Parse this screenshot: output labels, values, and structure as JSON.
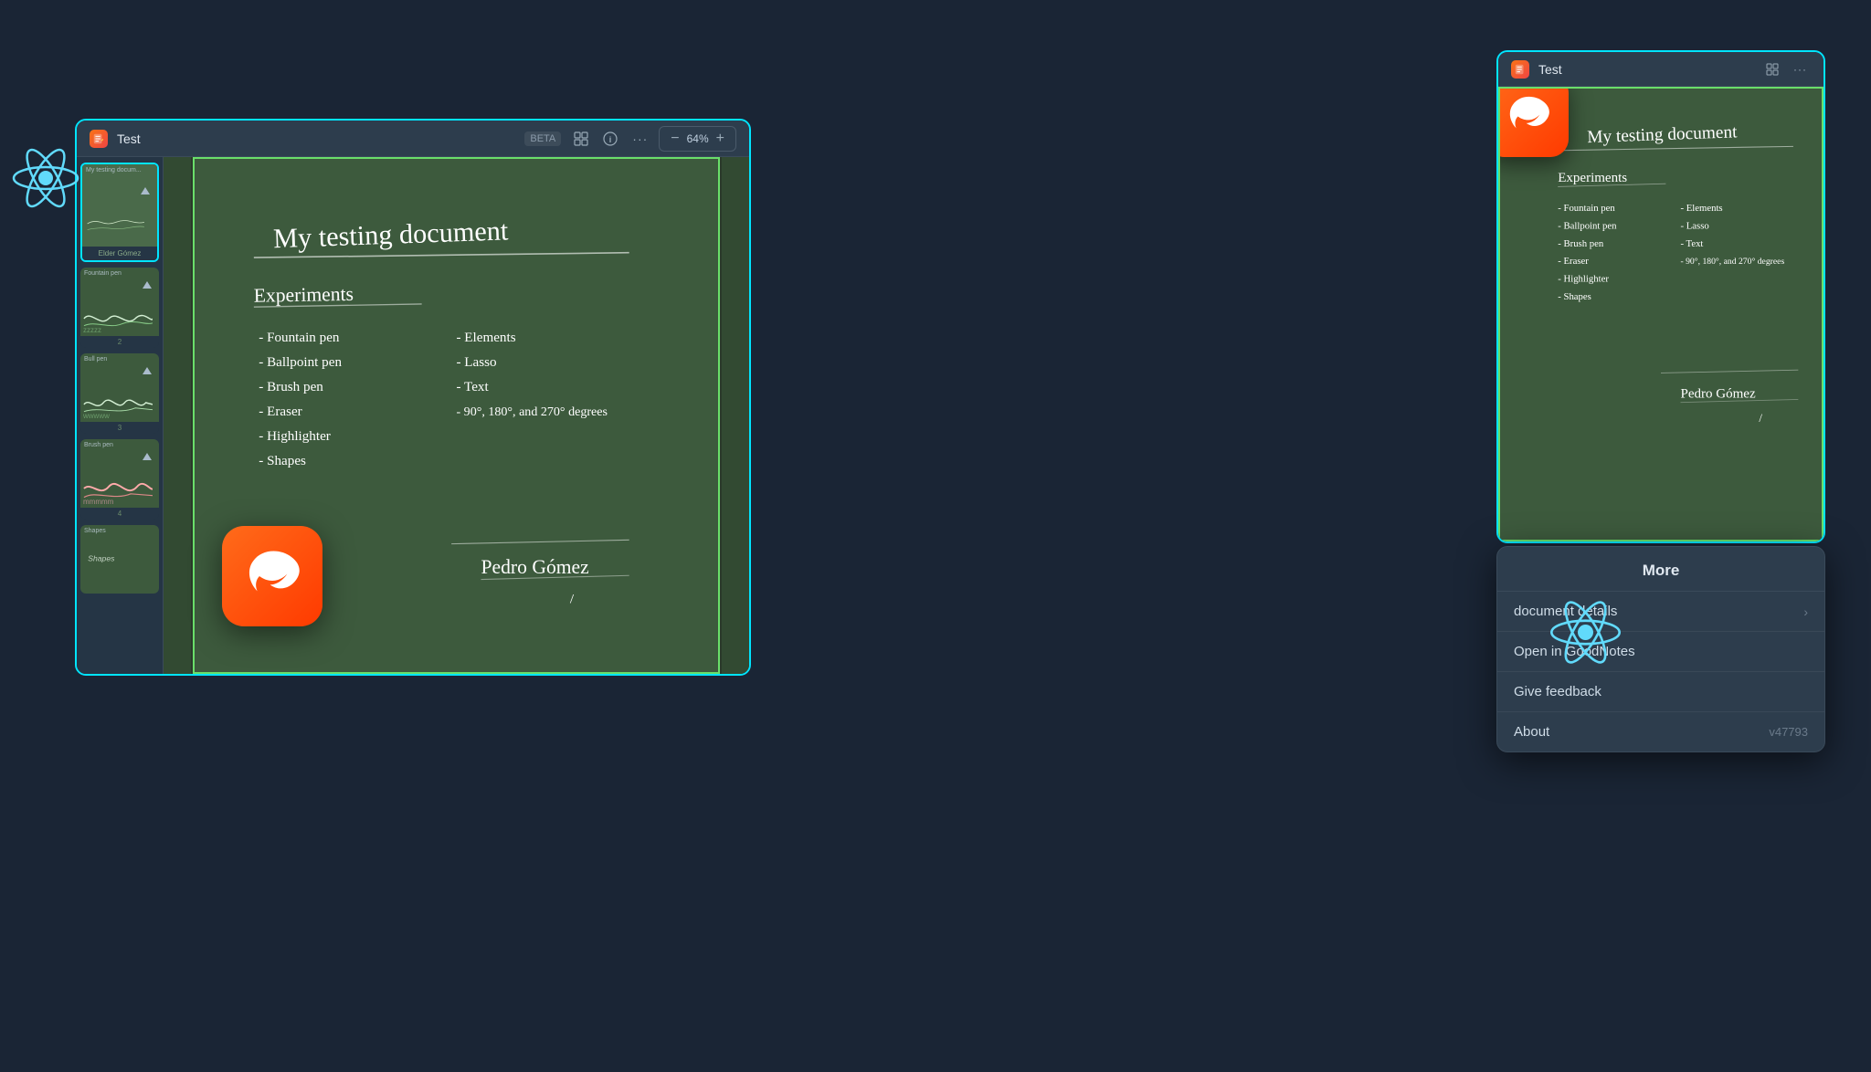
{
  "app": {
    "background_color": "#1a2535"
  },
  "main_window": {
    "title": "Test",
    "badge": "BETA",
    "zoom_value": "64%",
    "border_color": "#00e5ff",
    "page_border_color": "#6adf6a",
    "sidebar": {
      "pages": [
        {
          "num": "",
          "label": "My testing document",
          "active": true
        },
        {
          "num": "2",
          "label": "Fountain pen"
        },
        {
          "num": "3",
          "label": "Bull pen"
        },
        {
          "num": "4",
          "label": "Brush pen"
        },
        {
          "num": "",
          "label": "Shapes"
        }
      ]
    }
  },
  "document": {
    "title": "My testing document",
    "section": "Experiments",
    "items_col1": [
      "- Fountain pen",
      "- Ballpoint pen",
      "- Brush pen",
      "- Eraser",
      "- Highlighter",
      "- Shapes"
    ],
    "items_col2": [
      "- Elements",
      "- Lasso",
      "- Text",
      "- 90°, 180°, and 270° degrees"
    ],
    "signature": "Pedro Gómez"
  },
  "right_preview_window": {
    "title": "Test",
    "border_color": "#00e5ff",
    "page_border_color": "#6adf6a"
  },
  "more_panel": {
    "title": "More",
    "items": [
      {
        "label": "document details",
        "type": "nav",
        "value": ""
      },
      {
        "label": "Open in GoodNotes",
        "type": "action",
        "value": ""
      },
      {
        "label": "Give feedback",
        "type": "action",
        "value": ""
      },
      {
        "label": "About",
        "type": "info",
        "value": "v47793"
      }
    ]
  },
  "icons": {
    "grid_icon": "⊞",
    "more_icon": "···",
    "zoom_in": "⊕",
    "zoom_out": "⊖",
    "info": "ⓘ",
    "layout": "⊟",
    "chevron_right": "›"
  }
}
